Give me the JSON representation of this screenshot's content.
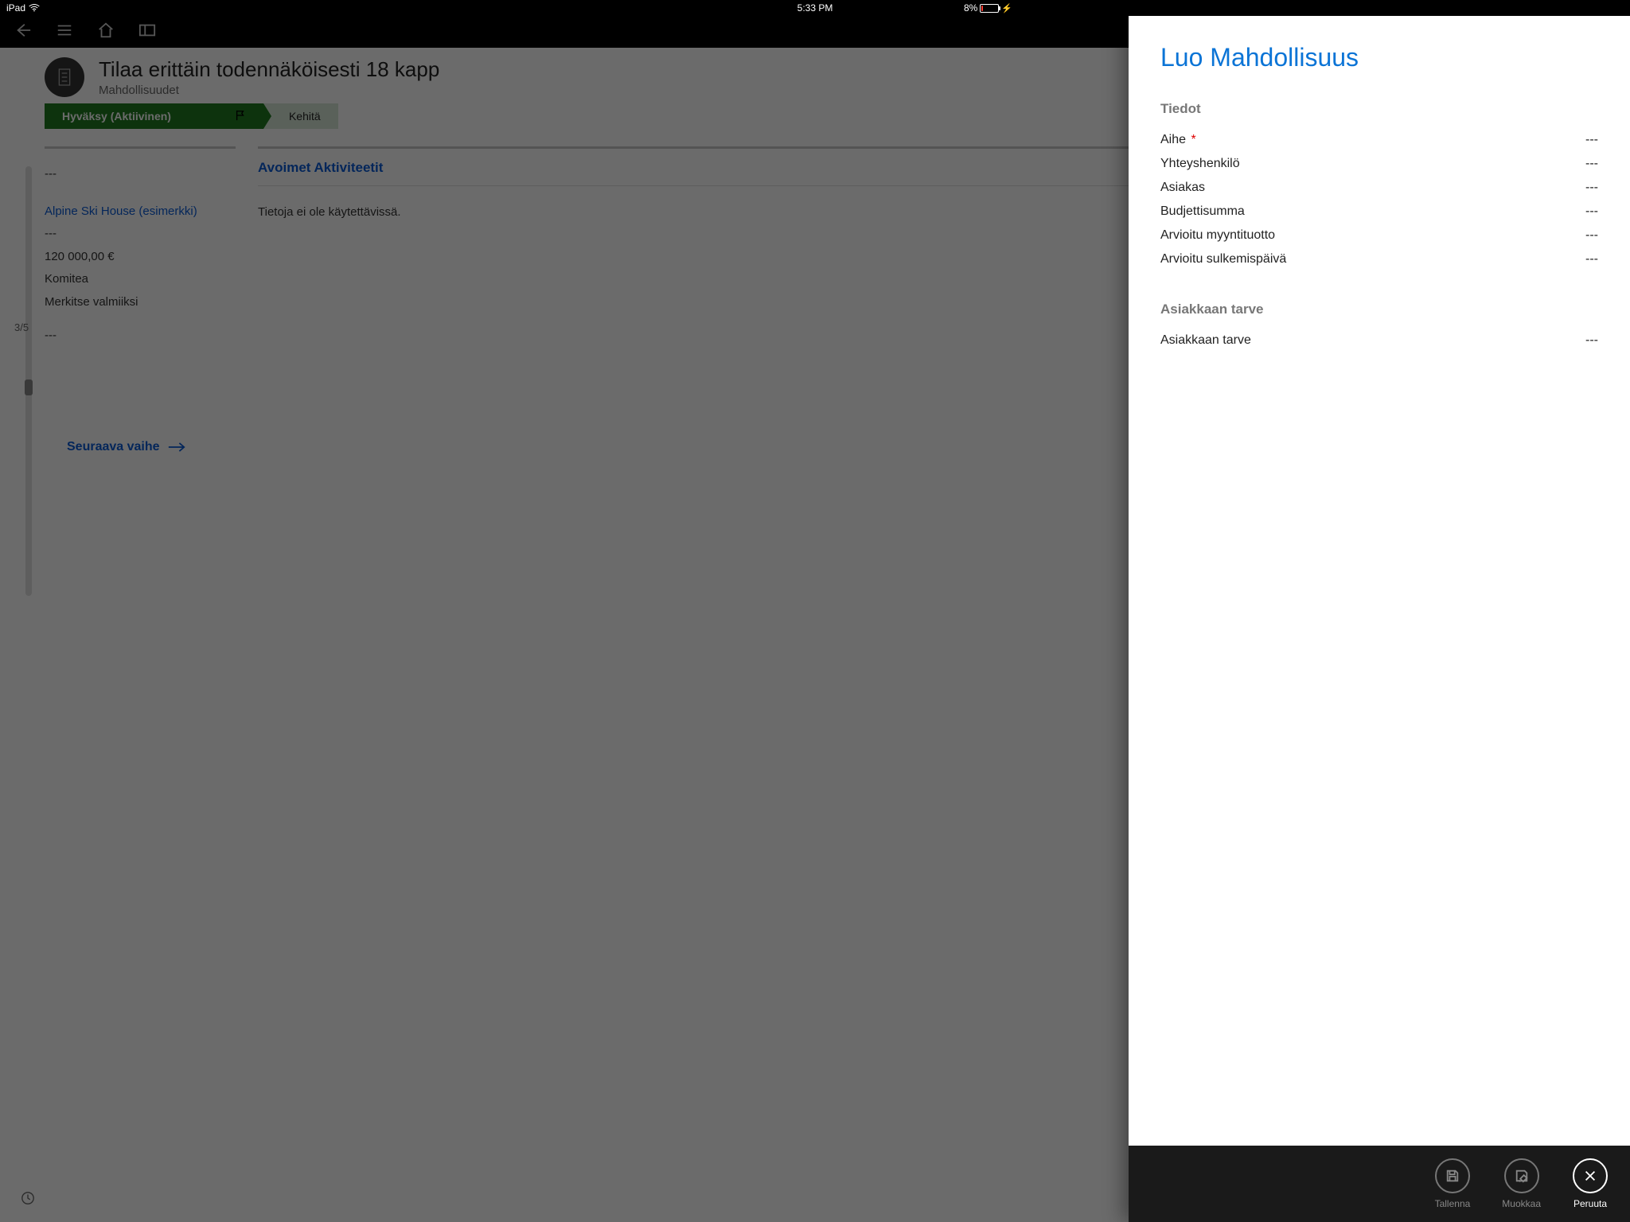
{
  "status": {
    "device": "iPad",
    "time": "5:33 PM",
    "battery_pct": "8%"
  },
  "bg": {
    "title": "Tilaa erittäin todennäköisesti 18 kapp",
    "subtitle": "Mahdollisuudet",
    "stage_active": "Hyväksy (Aktiivinen)",
    "stage_next": "Kehitä",
    "dash": "---",
    "link_name": "Alpine Ski House (esimerkki)",
    "amount": "120 000,00 €",
    "committee": "Komitea",
    "mark_done": "Merkitse valmiiksi",
    "next_step": "Seuraava vaihe",
    "pager": "3/5",
    "mid_title": "Avoimet Aktiviteetit",
    "mid_empty": "Tietoja ei ole käytettävissä."
  },
  "panel": {
    "title": "Luo Mahdollisuus",
    "sect1": "Tiedot",
    "fields1": [
      {
        "label": "Aihe",
        "required": true,
        "value": "---"
      },
      {
        "label": "Yhteyshenkilö",
        "required": false,
        "value": "---"
      },
      {
        "label": "Asiakas",
        "required": false,
        "value": "---"
      },
      {
        "label": "Budjettisumma",
        "required": false,
        "value": "---"
      },
      {
        "label": "Arvioitu myyntituotto",
        "required": false,
        "value": "---"
      },
      {
        "label": "Arvioitu sulkemispäivä",
        "required": false,
        "value": "---"
      }
    ],
    "sect2": "Asiakkaan tarve",
    "fields2": [
      {
        "label": "Asiakkaan tarve",
        "required": false,
        "value": "---"
      }
    ]
  },
  "actions": {
    "save": "Tallenna",
    "edit": "Muokkaa",
    "cancel": "Peruuta"
  }
}
